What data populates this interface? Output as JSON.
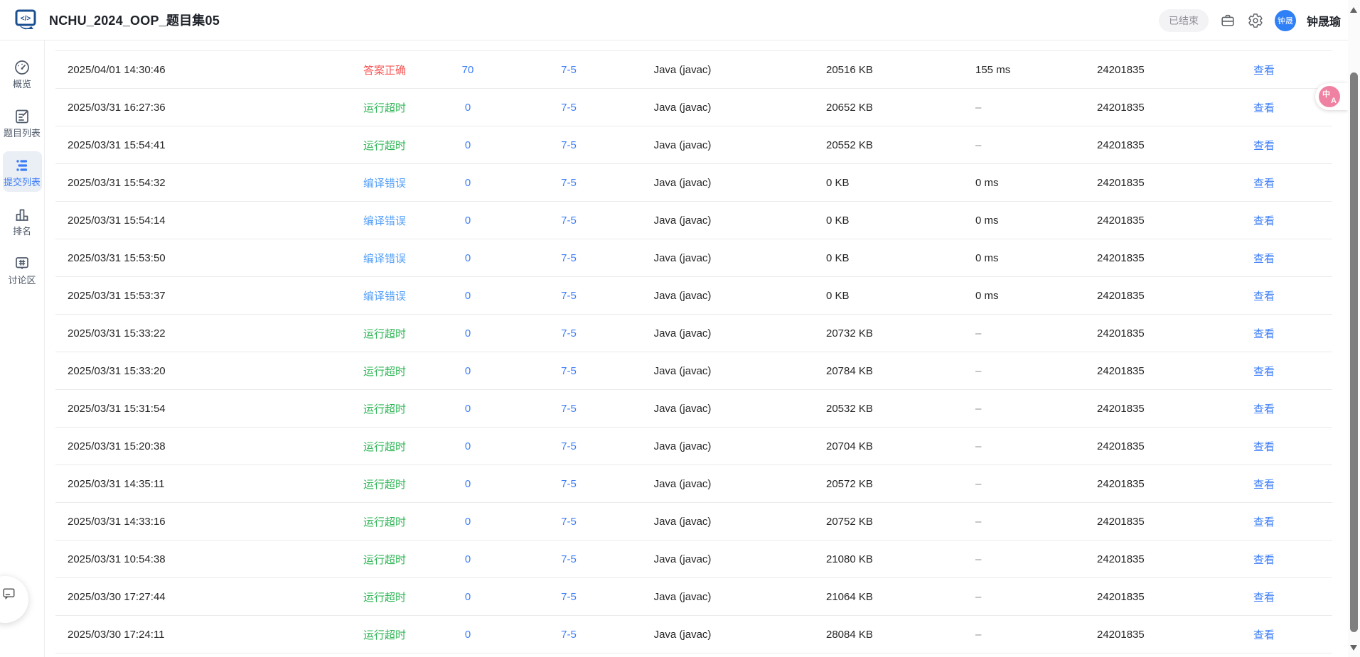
{
  "app": {
    "title": "NCHU_2024_OOP_题目集05",
    "status_badge": "已结束",
    "user": {
      "name": "钟晟瑜",
      "avatar_text": "钟晟"
    }
  },
  "sidebar": {
    "items": [
      {
        "label": "概览",
        "icon": "gauge-icon",
        "active": false
      },
      {
        "label": "题目列表",
        "icon": "problem-list-icon",
        "active": false
      },
      {
        "label": "提交列表",
        "icon": "submission-list-icon",
        "active": true
      },
      {
        "label": "排名",
        "icon": "ranking-icon",
        "active": false
      },
      {
        "label": "讨论区",
        "icon": "discussion-icon",
        "active": false
      }
    ]
  },
  "table": {
    "action_label": "查看",
    "rows": [
      {
        "time": "2025/04/01 14:30:46",
        "status": "答案正确",
        "status_key": "accepted",
        "score": "70",
        "problem": "7-5",
        "compiler": "Java (javac)",
        "memory": "20516 KB",
        "time_cost": "155 ms",
        "user": "24201835"
      },
      {
        "time": "2025/03/31 16:27:36",
        "status": "运行超时",
        "status_key": "timeout",
        "score": "0",
        "problem": "7-5",
        "compiler": "Java (javac)",
        "memory": "20652 KB",
        "time_cost": "–",
        "user": "24201835"
      },
      {
        "time": "2025/03/31 15:54:41",
        "status": "运行超时",
        "status_key": "timeout",
        "score": "0",
        "problem": "7-5",
        "compiler": "Java (javac)",
        "memory": "20552 KB",
        "time_cost": "–",
        "user": "24201835"
      },
      {
        "time": "2025/03/31 15:54:32",
        "status": "编译错误",
        "status_key": "compile_error",
        "score": "0",
        "problem": "7-5",
        "compiler": "Java (javac)",
        "memory": "0 KB",
        "time_cost": "0 ms",
        "user": "24201835"
      },
      {
        "time": "2025/03/31 15:54:14",
        "status": "编译错误",
        "status_key": "compile_error",
        "score": "0",
        "problem": "7-5",
        "compiler": "Java (javac)",
        "memory": "0 KB",
        "time_cost": "0 ms",
        "user": "24201835"
      },
      {
        "time": "2025/03/31 15:53:50",
        "status": "编译错误",
        "status_key": "compile_error",
        "score": "0",
        "problem": "7-5",
        "compiler": "Java (javac)",
        "memory": "0 KB",
        "time_cost": "0 ms",
        "user": "24201835"
      },
      {
        "time": "2025/03/31 15:53:37",
        "status": "编译错误",
        "status_key": "compile_error",
        "score": "0",
        "problem": "7-5",
        "compiler": "Java (javac)",
        "memory": "0 KB",
        "time_cost": "0 ms",
        "user": "24201835"
      },
      {
        "time": "2025/03/31 15:33:22",
        "status": "运行超时",
        "status_key": "timeout",
        "score": "0",
        "problem": "7-5",
        "compiler": "Java (javac)",
        "memory": "20732 KB",
        "time_cost": "–",
        "user": "24201835"
      },
      {
        "time": "2025/03/31 15:33:20",
        "status": "运行超时",
        "status_key": "timeout",
        "score": "0",
        "problem": "7-5",
        "compiler": "Java (javac)",
        "memory": "20784 KB",
        "time_cost": "–",
        "user": "24201835"
      },
      {
        "time": "2025/03/31 15:31:54",
        "status": "运行超时",
        "status_key": "timeout",
        "score": "0",
        "problem": "7-5",
        "compiler": "Java (javac)",
        "memory": "20532 KB",
        "time_cost": "–",
        "user": "24201835"
      },
      {
        "time": "2025/03/31 15:20:38",
        "status": "运行超时",
        "status_key": "timeout",
        "score": "0",
        "problem": "7-5",
        "compiler": "Java (javac)",
        "memory": "20704 KB",
        "time_cost": "–",
        "user": "24201835"
      },
      {
        "time": "2025/03/31 14:35:11",
        "status": "运行超时",
        "status_key": "timeout",
        "score": "0",
        "problem": "7-5",
        "compiler": "Java (javac)",
        "memory": "20572 KB",
        "time_cost": "–",
        "user": "24201835"
      },
      {
        "time": "2025/03/31 14:33:16",
        "status": "运行超时",
        "status_key": "timeout",
        "score": "0",
        "problem": "7-5",
        "compiler": "Java (javac)",
        "memory": "20752 KB",
        "time_cost": "–",
        "user": "24201835"
      },
      {
        "time": "2025/03/31 10:54:38",
        "status": "运行超时",
        "status_key": "timeout",
        "score": "0",
        "problem": "7-5",
        "compiler": "Java (javac)",
        "memory": "21080 KB",
        "time_cost": "–",
        "user": "24201835"
      },
      {
        "time": "2025/03/30 17:27:44",
        "status": "运行超时",
        "status_key": "timeout",
        "score": "0",
        "problem": "7-5",
        "compiler": "Java (javac)",
        "memory": "21064 KB",
        "time_cost": "–",
        "user": "24201835"
      },
      {
        "time": "2025/03/30 17:24:11",
        "status": "运行超时",
        "status_key": "timeout",
        "score": "0",
        "problem": "7-5",
        "compiler": "Java (javac)",
        "memory": "28084 KB",
        "time_cost": "–",
        "user": "24201835"
      }
    ]
  },
  "floating": {
    "translate_primary": "中",
    "translate_secondary": "A"
  },
  "colors": {
    "accent": "#3d7ef8",
    "status": {
      "accepted": "#f85454",
      "timeout": "#2bb553",
      "compile_error": "#56a0f8"
    },
    "sidebar_active": "#3b7cf7",
    "avatar_bg": "#2f80f7",
    "translate_pink": "#ef82a2"
  }
}
